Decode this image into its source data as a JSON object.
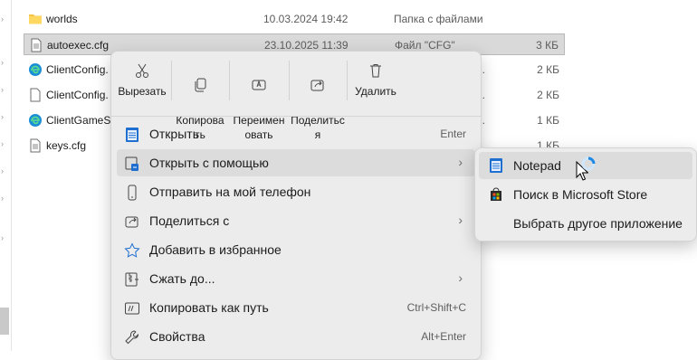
{
  "files": [
    {
      "name": "worlds",
      "date": "10.03.2024 19:42",
      "type": "Папка с файлами",
      "size": "",
      "icon": "folder-icon",
      "truncated_type": ""
    },
    {
      "name": "autoexec.cfg",
      "date": "23.10.2025 11:39",
      "type": "Файл \"CFG\"",
      "size": "3 КБ",
      "icon": "file-icon",
      "truncated_type": ""
    },
    {
      "name": "ClientConfig.",
      "date": "",
      "type": "",
      "size": "2 КБ",
      "icon": "edge-icon",
      "truncated_type": "..."
    },
    {
      "name": "ClientConfig.",
      "date": "",
      "type": "",
      "size": "2 КБ",
      "icon": "file-icon",
      "truncated_type": "..."
    },
    {
      "name": "ClientGameSe",
      "date": "",
      "type": "",
      "size": "1 КБ",
      "icon": "edge-icon",
      "truncated_type": "..."
    },
    {
      "name": "keys.cfg",
      "date": "",
      "type": "",
      "size": "1 КБ",
      "icon": "file-icon",
      "truncated_type": ""
    }
  ],
  "context_menu": {
    "quick_actions": [
      {
        "label": "Вырезать",
        "icon": "scissors-icon"
      },
      {
        "label": "Копирова\nть",
        "icon": "copy-icon"
      },
      {
        "label": "Переимен\nовать",
        "icon": "rename-icon"
      },
      {
        "label": "Поделитьс\nя",
        "icon": "share-icon"
      },
      {
        "label": "Удалить",
        "icon": "trash-icon"
      }
    ],
    "items": [
      {
        "label": "Открыть",
        "shortcut": "Enter",
        "icon": "notepad-icon"
      },
      {
        "label": "Открыть с помощью",
        "shortcut": "",
        "icon": "open-with-icon",
        "submenu": true
      },
      {
        "label": "Отправить на мой телефон",
        "shortcut": "",
        "icon": "phone-icon"
      },
      {
        "label": "Поделиться с",
        "shortcut": "",
        "icon": "share-icon",
        "submenu": true
      },
      {
        "label": "Добавить в избранное",
        "shortcut": "",
        "icon": "star-icon"
      },
      {
        "label": "Сжать до...",
        "shortcut": "",
        "icon": "zip-icon",
        "submenu": true
      },
      {
        "label": "Копировать как путь",
        "shortcut": "Ctrl+Shift+C",
        "icon": "path-icon"
      },
      {
        "label": "Свойства",
        "shortcut": "Alt+Enter",
        "icon": "wrench-icon"
      }
    ]
  },
  "submenu": {
    "items": [
      {
        "label": "Notepad",
        "icon": "notepad-icon"
      },
      {
        "label": "Поиск в Microsoft Store",
        "icon": "store-icon"
      },
      {
        "label": "Выбрать другое приложение",
        "icon": ""
      }
    ]
  },
  "colors": {
    "accent": "#0067c0",
    "menu_bg": "#ececec",
    "hover": "#dcdcdc",
    "selection": "#d9d9d9"
  }
}
